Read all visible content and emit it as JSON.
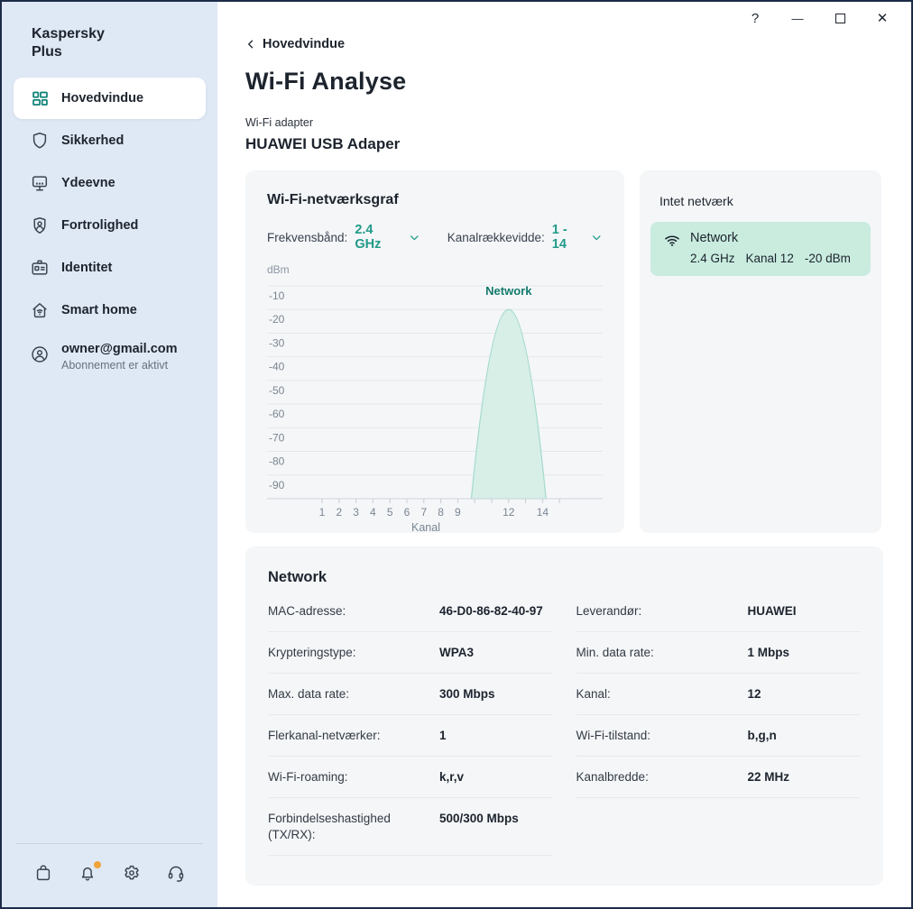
{
  "window_controls": {
    "help": "?",
    "minimize": "—",
    "close": "✕",
    "maximize_icon": "square-outline"
  },
  "sidebar": {
    "brand_line1": "Kaspersky",
    "brand_line2": "Plus",
    "items": [
      {
        "id": "hovedvindue",
        "label": "Hovedvindue",
        "icon": "grid-icon",
        "active": true
      },
      {
        "id": "sikkerhed",
        "label": "Sikkerhed",
        "icon": "shield-icon",
        "active": false
      },
      {
        "id": "ydeevne",
        "label": "Ydeevne",
        "icon": "monitor-icon",
        "active": false
      },
      {
        "id": "fortrolighed",
        "label": "Fortrolighed",
        "icon": "privacy-badge-icon",
        "active": false
      },
      {
        "id": "identitet",
        "label": "Identitet",
        "icon": "id-card-icon",
        "active": false
      },
      {
        "id": "smart-home",
        "label": "Smart home",
        "icon": "home-wifi-icon",
        "active": false
      }
    ],
    "account": {
      "email": "owner@gmail.com",
      "status": "Abonnement er aktivt",
      "icon": "account-icon"
    },
    "footer_icons": [
      {
        "id": "store",
        "icon": "bag-icon",
        "badge": false
      },
      {
        "id": "notifications",
        "icon": "bell-icon",
        "badge": true
      },
      {
        "id": "settings",
        "icon": "gear-icon",
        "badge": false
      },
      {
        "id": "support",
        "icon": "headset-icon",
        "badge": false
      }
    ]
  },
  "header": {
    "back_label": "Hovedvindue",
    "title": "Wi-Fi Analyse",
    "adapter_label": "Wi-Fi adapter",
    "adapter_name": "HUAWEI USB Adaper"
  },
  "graph_card": {
    "title": "Wi-Fi-netværksgraf",
    "band_label": "Frekvensbånd:",
    "band_value": "2.4 GHz",
    "range_label": "Kanalrækkevidde:",
    "range_value": "1 - 14",
    "unit": "dBm"
  },
  "chart_data": {
    "type": "area",
    "title": "Wi-Fi-netværksgraf",
    "xlabel": "Kanal",
    "ylabel": "dBm",
    "ylim": [
      -100,
      -10
    ],
    "y_ticks": [
      -10,
      -20,
      -30,
      -40,
      -50,
      -60,
      -70,
      -80,
      -90
    ],
    "x_channels": [
      1,
      15
    ],
    "x_tick_labels": [
      1,
      2,
      3,
      4,
      5,
      6,
      7,
      8,
      9,
      12,
      14
    ],
    "grid": true,
    "series": [
      {
        "name": "Network",
        "shape": "parabolic-lobe",
        "center_channel": 12,
        "half_width_channels": 2.2,
        "peak_dbm": -20,
        "base_dbm": -100,
        "label_color": "#147a6d"
      }
    ]
  },
  "network_list": {
    "title": "Intet netværk",
    "items": [
      {
        "name": "Network",
        "band": "2.4 GHz",
        "channel": "Kanal 12",
        "signal": "-20 dBm",
        "selected": true,
        "icon": "wifi-icon"
      }
    ]
  },
  "details_card": {
    "title": "Network",
    "left_rows": [
      {
        "label": "MAC-adresse:",
        "value": "46-D0-86-82-40-97"
      },
      {
        "label": "Krypteringstype:",
        "value": "WPA3"
      },
      {
        "label": "Max. data rate:",
        "value": "300 Mbps"
      },
      {
        "label": "Flerkanal-netværker:",
        "value": "1"
      },
      {
        "label": "Wi-Fi-roaming:",
        "value": "k,r,v"
      },
      {
        "label": "Forbindelseshastighed (TX/RX):",
        "value": "500/300 Mbps"
      }
    ],
    "right_rows": [
      {
        "label": "Leverandør:",
        "value": "HUAWEI"
      },
      {
        "label": "Min. data rate:",
        "value": "1 Mbps"
      },
      {
        "label": "Kanal:",
        "value": "12"
      },
      {
        "label": "Wi-Fi-tilstand:",
        "value": "b,g,n"
      },
      {
        "label": "Kanalbredde:",
        "value": "22 MHz"
      }
    ]
  },
  "colors": {
    "accent_teal": "#219a88",
    "icon_teal": "#0e8276",
    "curve_fill": "#d7efe7",
    "curve_stroke": "#a4d9cc",
    "series_label": "#147a6d",
    "mint_selected": "#c9ecdf",
    "sidebar_bg": "#dfe8f5",
    "card_bg": "#f4f6f8",
    "gridline": "#e4e8ed",
    "baseline": "#d7dce2",
    "axis_text": "#7a8591",
    "notification_dot": "#f2a33c",
    "window_border": "#1c2b47"
  }
}
